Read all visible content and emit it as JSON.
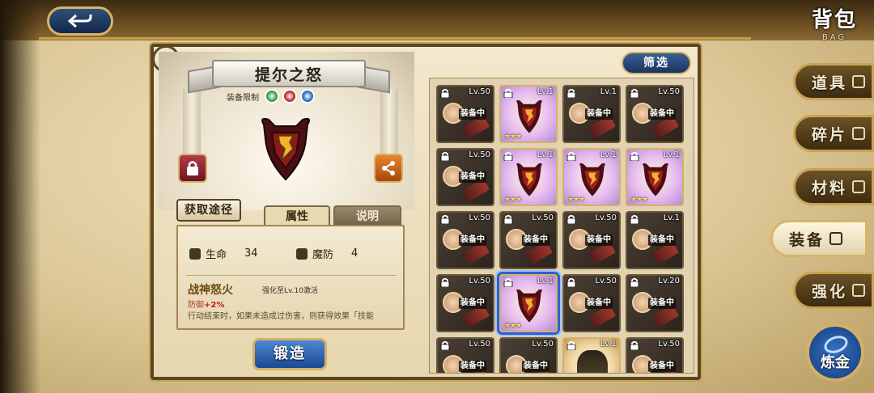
{
  "header": {
    "title": "背包",
    "subtitle": "BAG"
  },
  "side_tabs": [
    {
      "label": "道具",
      "icon": "flask-icon"
    },
    {
      "label": "碎片",
      "icon": "fragment-icon"
    },
    {
      "label": "材料",
      "icon": "material-icon"
    },
    {
      "label": "装备",
      "icon": "equipment-icon",
      "active": true
    },
    {
      "label": "强化",
      "icon": "enhance-icon"
    }
  ],
  "alchemy_label": "炼金",
  "detail": {
    "item_name": "提尔之怒",
    "limit_label": "装备限制",
    "limit_classes": [
      "#3a9a3a",
      "#c22a2a",
      "#2a6ac2"
    ],
    "obtain_label": "获取途径",
    "tabs": {
      "attributes": "属性",
      "description": "说明"
    },
    "stats": [
      {
        "label": "生命",
        "value": "34",
        "icon": "heart-icon"
      },
      {
        "label": "魔防",
        "value": "4",
        "icon": "magic-defense-icon"
      }
    ],
    "skill": {
      "name": "战神怒火",
      "unlock": "强化至Lv.10激活",
      "effect_prefix": "防御",
      "effect_value": "+2%",
      "description": "行动结束时，如果未造成过伤害，则获得效果「技能"
    },
    "forge_label": "锻造"
  },
  "filter_label": "筛选",
  "equip_badge": "装备中",
  "inventory": [
    {
      "level": "Lv.50",
      "locked": true,
      "equipped": true,
      "type": "dark"
    },
    {
      "level": "Lv.1",
      "locked": true,
      "equipped": false,
      "type": "rare"
    },
    {
      "level": "Lv.1",
      "locked": true,
      "equipped": true,
      "type": "dark"
    },
    {
      "level": "Lv.50",
      "locked": true,
      "equipped": true,
      "type": "dark"
    },
    {
      "level": "Lv.50",
      "locked": true,
      "equipped": true,
      "type": "dark"
    },
    {
      "level": "Lv.1",
      "locked": true,
      "equipped": false,
      "type": "rare"
    },
    {
      "level": "Lv.1",
      "locked": true,
      "equipped": false,
      "type": "rare"
    },
    {
      "level": "Lv.1",
      "locked": true,
      "equipped": false,
      "type": "rare"
    },
    {
      "level": "Lv.50",
      "locked": true,
      "equipped": true,
      "type": "dark"
    },
    {
      "level": "Lv.50",
      "locked": true,
      "equipped": true,
      "type": "dark"
    },
    {
      "level": "Lv.50",
      "locked": true,
      "equipped": true,
      "type": "dark"
    },
    {
      "level": "Lv.1",
      "locked": true,
      "equipped": true,
      "type": "dark"
    },
    {
      "level": "Lv.50",
      "locked": true,
      "equipped": true,
      "type": "dark"
    },
    {
      "level": "Lv.1",
      "locked": true,
      "equipped": false,
      "type": "rare",
      "selected": true
    },
    {
      "level": "Lv.50",
      "locked": true,
      "equipped": true,
      "type": "dark"
    },
    {
      "level": "Lv.20",
      "locked": true,
      "equipped": true,
      "type": "dark"
    },
    {
      "level": "Lv.50",
      "locked": true,
      "equipped": true,
      "type": "dark"
    },
    {
      "level": "Lv.50",
      "locked": false,
      "equipped": true,
      "type": "dark"
    },
    {
      "level": "Lv.1",
      "locked": true,
      "equipped": false,
      "type": "gold"
    },
    {
      "level": "Lv.50",
      "locked": true,
      "equipped": true,
      "type": "dark"
    }
  ]
}
